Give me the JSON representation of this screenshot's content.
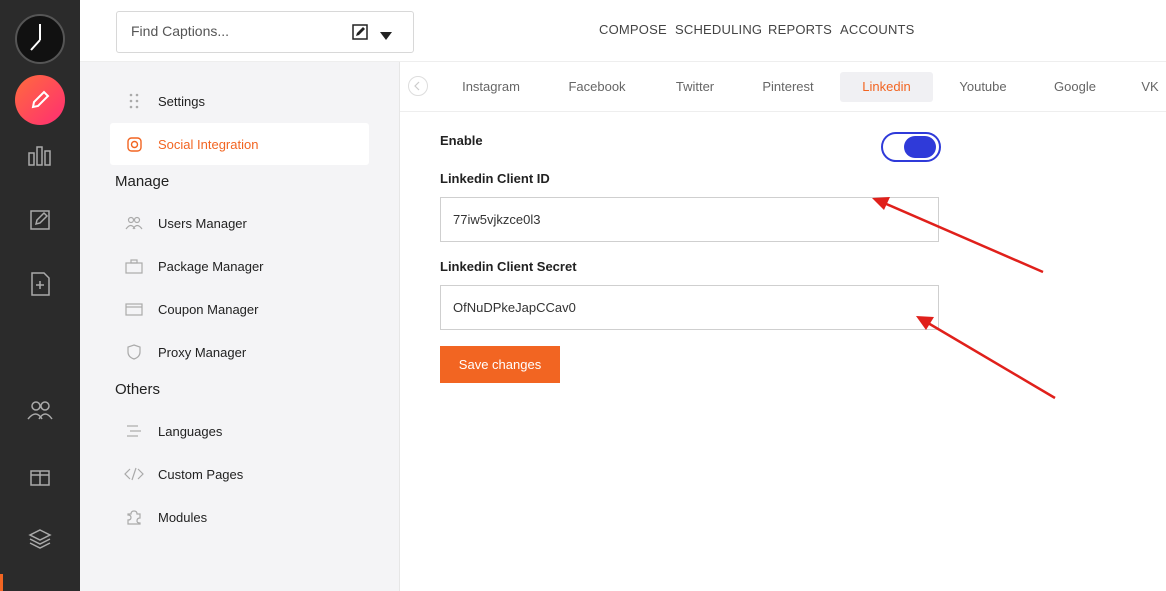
{
  "search": {
    "placeholder": "Find Captions..."
  },
  "topnav": [
    "COMPOSE",
    "SCHEDULING",
    "REPORTS",
    "ACCOUNTS"
  ],
  "sidebar": {
    "items": [
      {
        "label": "Settings",
        "icon": "grip-dots-icon"
      },
      {
        "label": "Social Integration",
        "icon": "instagram-icon",
        "active": true
      }
    ],
    "manage_heading": "Manage",
    "manage": [
      {
        "label": "Users Manager",
        "icon": "users-icon"
      },
      {
        "label": "Package Manager",
        "icon": "package-icon"
      },
      {
        "label": "Coupon Manager",
        "icon": "coupon-icon"
      },
      {
        "label": "Proxy Manager",
        "icon": "shield-icon"
      }
    ],
    "others_heading": "Others",
    "others": [
      {
        "label": "Languages",
        "icon": "languages-icon"
      },
      {
        "label": "Custom Pages",
        "icon": "code-icon"
      },
      {
        "label": "Modules",
        "icon": "puzzle-icon"
      }
    ]
  },
  "tabs": [
    "Instagram",
    "Facebook",
    "Twitter",
    "Pinterest",
    "Linkedin",
    "Youtube",
    "Google",
    "VK"
  ],
  "active_tab": "Linkedin",
  "form": {
    "enable_label": "Enable",
    "enabled": true,
    "client_id_label": "Linkedin Client ID",
    "client_id": "77iw5vjkzce0l3",
    "client_secret_label": "Linkedin Client Secret",
    "client_secret": "OfNuDPkeJapCCav0",
    "save_label": "Save changes"
  },
  "colors": {
    "accent": "#f26522",
    "toggle": "#2f3ad9",
    "annotation": "#e0201b"
  }
}
